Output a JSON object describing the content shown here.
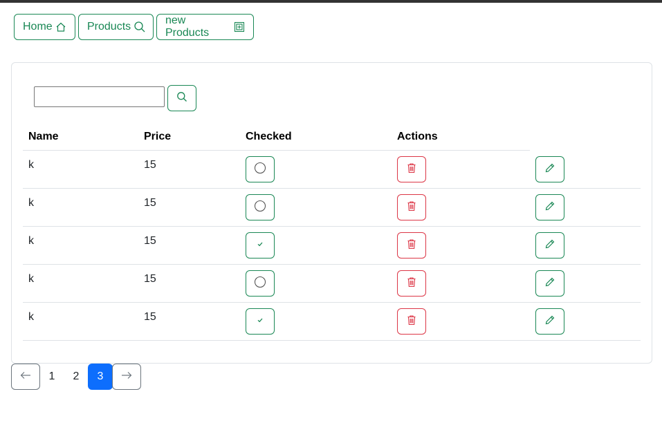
{
  "nav": {
    "home_label": "Home",
    "products_label": "Products",
    "new_products_label": "new Products"
  },
  "search": {
    "value": "",
    "placeholder": ""
  },
  "table": {
    "headers": {
      "name": "Name",
      "price": "Price",
      "checked": "Checked",
      "actions": "Actions"
    },
    "rows": [
      {
        "name": "k",
        "price": "15",
        "checked": false
      },
      {
        "name": "k",
        "price": "15",
        "checked": false
      },
      {
        "name": "k",
        "price": "15",
        "checked": true
      },
      {
        "name": "k",
        "price": "15",
        "checked": false
      },
      {
        "name": "k",
        "price": "15",
        "checked": true
      }
    ]
  },
  "pagination": {
    "prev_icon": "arrow-left-icon",
    "next_icon": "arrow-right-icon",
    "pages": [
      "1",
      "2",
      "3"
    ],
    "current": "3"
  },
  "colors": {
    "success": "#198754",
    "danger": "#dc3545",
    "primary": "#0d6efd",
    "secondary": "#6c757d"
  }
}
